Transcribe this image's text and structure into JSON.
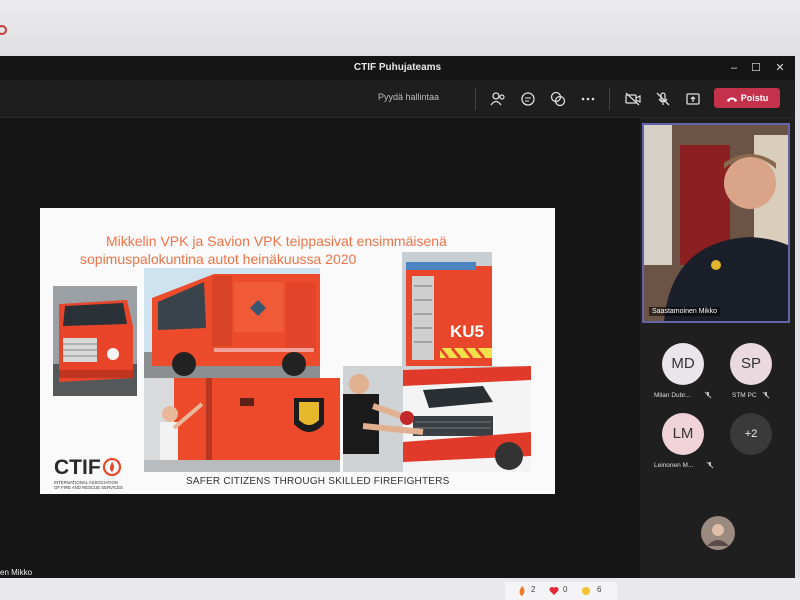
{
  "window": {
    "title": "CTIF Puhujateams",
    "minimize": "–",
    "maximize": "☐",
    "close": "✕"
  },
  "toolbar": {
    "request_control": "Pyydä hallintaa",
    "leave_label": "Poistu",
    "icons": [
      "people-icon",
      "chat-icon",
      "reactions-icon",
      "more-icon",
      "camera-off-icon",
      "mic-off-icon",
      "share-icon",
      "phone-icon"
    ]
  },
  "slide": {
    "title_line1": "Mikkelin VPK ja Savion VPK teippasivat ensimmäisenä",
    "title_line2": "sopimuspalokuntina autot heinäkuussa 2020",
    "truck_text": "KU5",
    "logo_text": "CTIF",
    "logo_sub1": "INTERNATIONAL ASSOCIATION",
    "logo_sub2": "OF FIRE AND RESCUE SERVICES",
    "tagline": "SAFER CITIZENS THROUGH SKILLED FIREFIGHTERS"
  },
  "self_view_name": "en Mikko",
  "video": {
    "name": "Saastamoinen Mikko"
  },
  "participants": [
    {
      "initials": "MD",
      "name": "Milan Dubr...",
      "color": "#e8e6ea"
    },
    {
      "initials": "SP",
      "name": "STM PC",
      "color": "#ead9de"
    },
    {
      "initials": "LM",
      "name": "Leinonen M...",
      "color": "#efd3d8"
    },
    {
      "initials": "+2",
      "name": "",
      "color": "#3a3a3a"
    }
  ],
  "reactions": {
    "fire": "2",
    "heart": "0",
    "clap": "6"
  },
  "colors": {
    "accent": "#6264a7",
    "leave": "#c4314b",
    "slide_title": "#f0734a"
  }
}
